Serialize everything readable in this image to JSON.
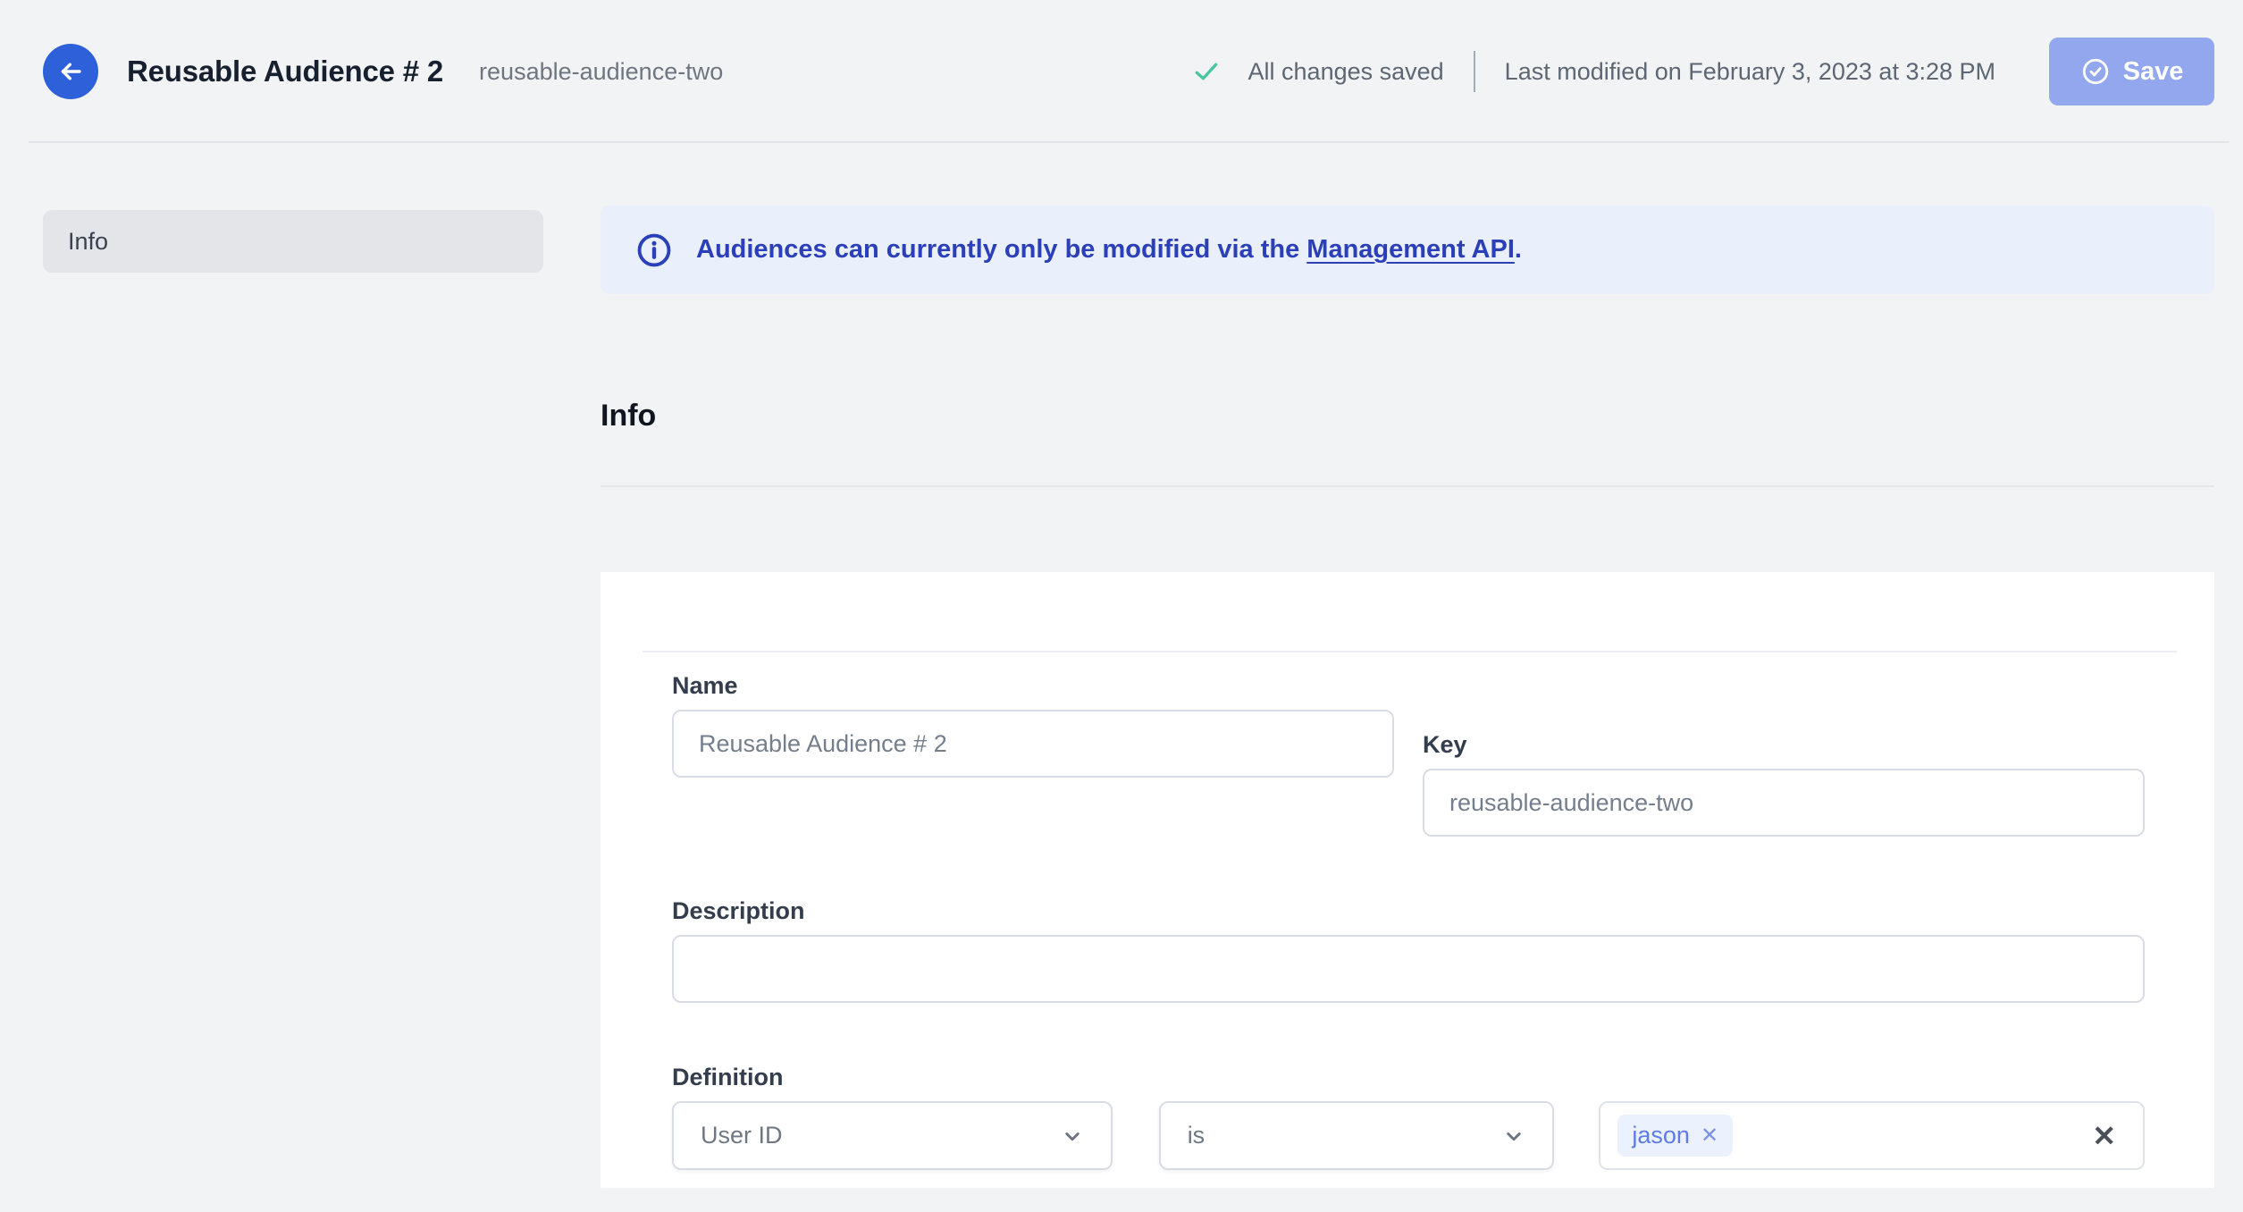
{
  "header": {
    "title": "Reusable Audience # 2",
    "slug": "reusable-audience-two",
    "status": "All changes saved",
    "last_modified": "Last modified on February 3, 2023 at 3:28 PM",
    "save_label": "Save"
  },
  "sidebar": {
    "items": [
      {
        "label": "Info",
        "active": true
      }
    ]
  },
  "banner": {
    "text_before": "Audiences can currently only be modified via the ",
    "link_text": "Management API",
    "text_after": "."
  },
  "section": {
    "title": "Info"
  },
  "form": {
    "name": {
      "label": "Name",
      "value": "Reusable Audience # 2"
    },
    "key": {
      "label": "Key",
      "value": "reusable-audience-two"
    },
    "description": {
      "label": "Description",
      "value": ""
    },
    "definition": {
      "label": "Definition",
      "trait": "User ID",
      "operator": "is",
      "values": [
        "jason"
      ]
    }
  },
  "colors": {
    "accent_blue": "#2E61D9",
    "save_button_bg": "#93A7EF",
    "banner_blue": "#2B3FB8",
    "success_green": "#4AC5A2",
    "tag_bg": "#EBF1FD",
    "tag_text": "#5F7BE8",
    "divider": "#E3E4E8"
  }
}
